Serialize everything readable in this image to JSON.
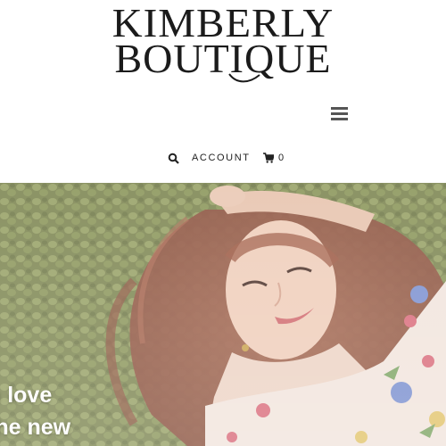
{
  "brand": {
    "line1": "KIMBERLY",
    "line2": "BOUTIQUE"
  },
  "header": {
    "menu_icon": "hamburger-menu-icon",
    "search_icon": "search-icon",
    "account_label": "ACCOUNT",
    "cart_icon": "cart-icon",
    "cart_count": "0"
  },
  "hero": {
    "headline_line1": "n love",
    "headline_line2": "the new"
  },
  "colors": {
    "text": "#1b1b1b",
    "nav_text": "#222222",
    "hero_text": "#ffffff",
    "foliage": "#7f8a52",
    "hair": "#9a5a45",
    "skin": "#ecc8b4"
  }
}
